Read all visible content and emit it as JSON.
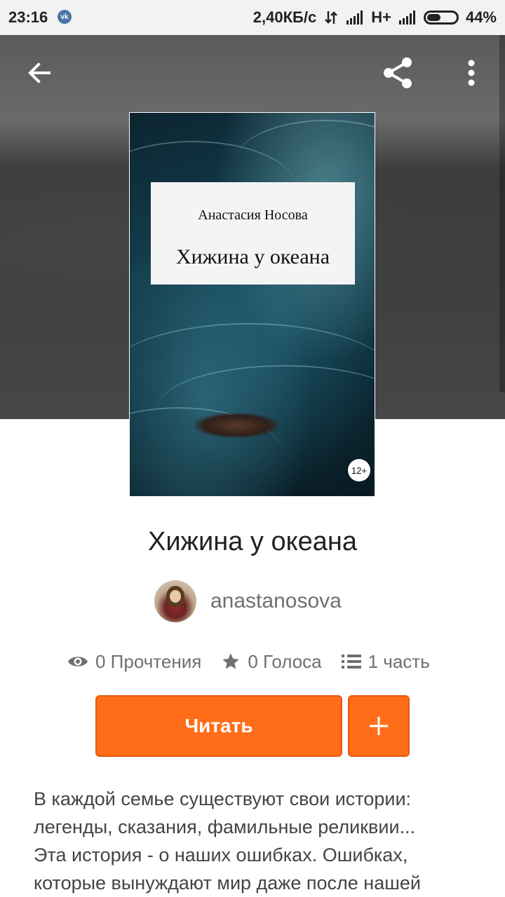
{
  "status_bar": {
    "time": "23:16",
    "network_speed": "2,40КБ/с",
    "network_type": "H+",
    "battery": "44%",
    "battery_level": 0.44,
    "icons": [
      "vk-icon",
      "data-transfer-icon",
      "signal-icon",
      "signal-icon",
      "battery-icon"
    ]
  },
  "toolbar": {
    "icons": [
      "back-arrow-icon",
      "share-icon",
      "more-vert-icon"
    ]
  },
  "cover": {
    "author": "Анастасия Носова",
    "title": "Хижина у океана",
    "age_rating": "12+"
  },
  "story": {
    "title": "Хижина у океана",
    "author": "anastanosova"
  },
  "stats": [
    {
      "icon": "eye-icon",
      "label": "0 Прочтения"
    },
    {
      "icon": "star-icon",
      "label": "0 Голоса"
    },
    {
      "icon": "list-icon",
      "label": "1 часть"
    }
  ],
  "actions": {
    "read_label": "Читать",
    "add_icon": "plus-icon"
  },
  "description": [
    "В каждой семье существуют свои истории:",
    "легенды, сказания, фамильные реликвии...",
    "Эта история - о наших ошибках. Ошибках,",
    "которые вынуждают мир даже после нашей"
  ],
  "colors": {
    "accent": "#ff6d1a",
    "accent_border": "#e8590c",
    "text_primary": "#222222",
    "text_secondary": "#6f6f6f"
  }
}
